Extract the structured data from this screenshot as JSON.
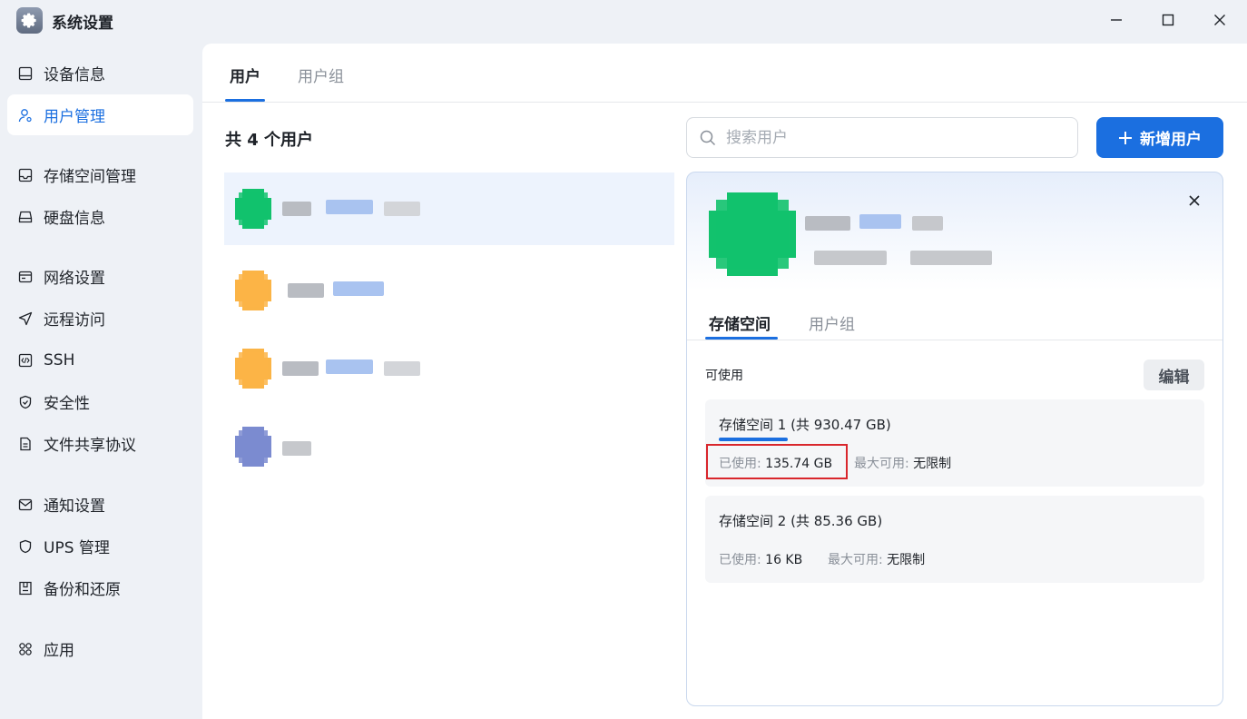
{
  "window": {
    "title": "系统设置"
  },
  "sidebar": {
    "items": [
      {
        "label": "设备信息",
        "icon": "monitor-icon",
        "active": false
      },
      {
        "label": "用户管理",
        "icon": "user-gear-icon",
        "active": true
      },
      {
        "label": "存储空间管理",
        "icon": "storage-icon",
        "active": false
      },
      {
        "label": "硬盘信息",
        "icon": "disk-icon",
        "active": false
      },
      {
        "label": "网络设置",
        "icon": "network-icon",
        "active": false
      },
      {
        "label": "远程访问",
        "icon": "send-icon",
        "active": false
      },
      {
        "label": "SSH",
        "icon": "code-icon",
        "active": false
      },
      {
        "label": "安全性",
        "icon": "shield-check-icon",
        "active": false
      },
      {
        "label": "文件共享协议",
        "icon": "document-icon",
        "active": false
      },
      {
        "label": "通知设置",
        "icon": "mail-icon",
        "active": false
      },
      {
        "label": "UPS 管理",
        "icon": "shield-icon",
        "active": false
      },
      {
        "label": "备份和还原",
        "icon": "backup-icon",
        "active": false
      },
      {
        "label": "应用",
        "icon": "apps-icon",
        "active": false
      }
    ]
  },
  "main": {
    "tabs": [
      {
        "label": "用户",
        "active": true
      },
      {
        "label": "用户组",
        "active": false
      }
    ],
    "list_title": "共 4 个用户",
    "search": {
      "placeholder": "搜索用户",
      "value": ""
    },
    "add_button": "新增用户",
    "users": [
      {
        "avatar_color": "#12c26d",
        "selected": true
      },
      {
        "avatar_color": "#fbb446",
        "selected": false
      },
      {
        "avatar_color": "#fbb446",
        "selected": false
      },
      {
        "avatar_color": "#7b8bd0",
        "selected": false
      }
    ]
  },
  "detail": {
    "avatar_color": "#12c26d",
    "tabs": [
      {
        "label": "存储空间",
        "active": true
      },
      {
        "label": "用户组",
        "active": false
      }
    ],
    "available_label": "可使用",
    "edit_button": "编辑",
    "storages": [
      {
        "title": "存储空间 1 (共 930.47 GB)",
        "used_label": "已使用:",
        "used_value": "135.74 GB",
        "max_label": "最大可用:",
        "max_value": "无限制",
        "usage_ratio": 0.1459,
        "highlighted": true
      },
      {
        "title": "存储空间 2 (共 85.36 GB)",
        "used_label": "已使用:",
        "used_value": "16 KB",
        "max_label": "最大可用:",
        "max_value": "无限制",
        "usage_ratio": 0.0,
        "highlighted": false
      }
    ]
  },
  "colors": {
    "accent": "#1b6fe0",
    "highlight_box": "#d9262c"
  }
}
